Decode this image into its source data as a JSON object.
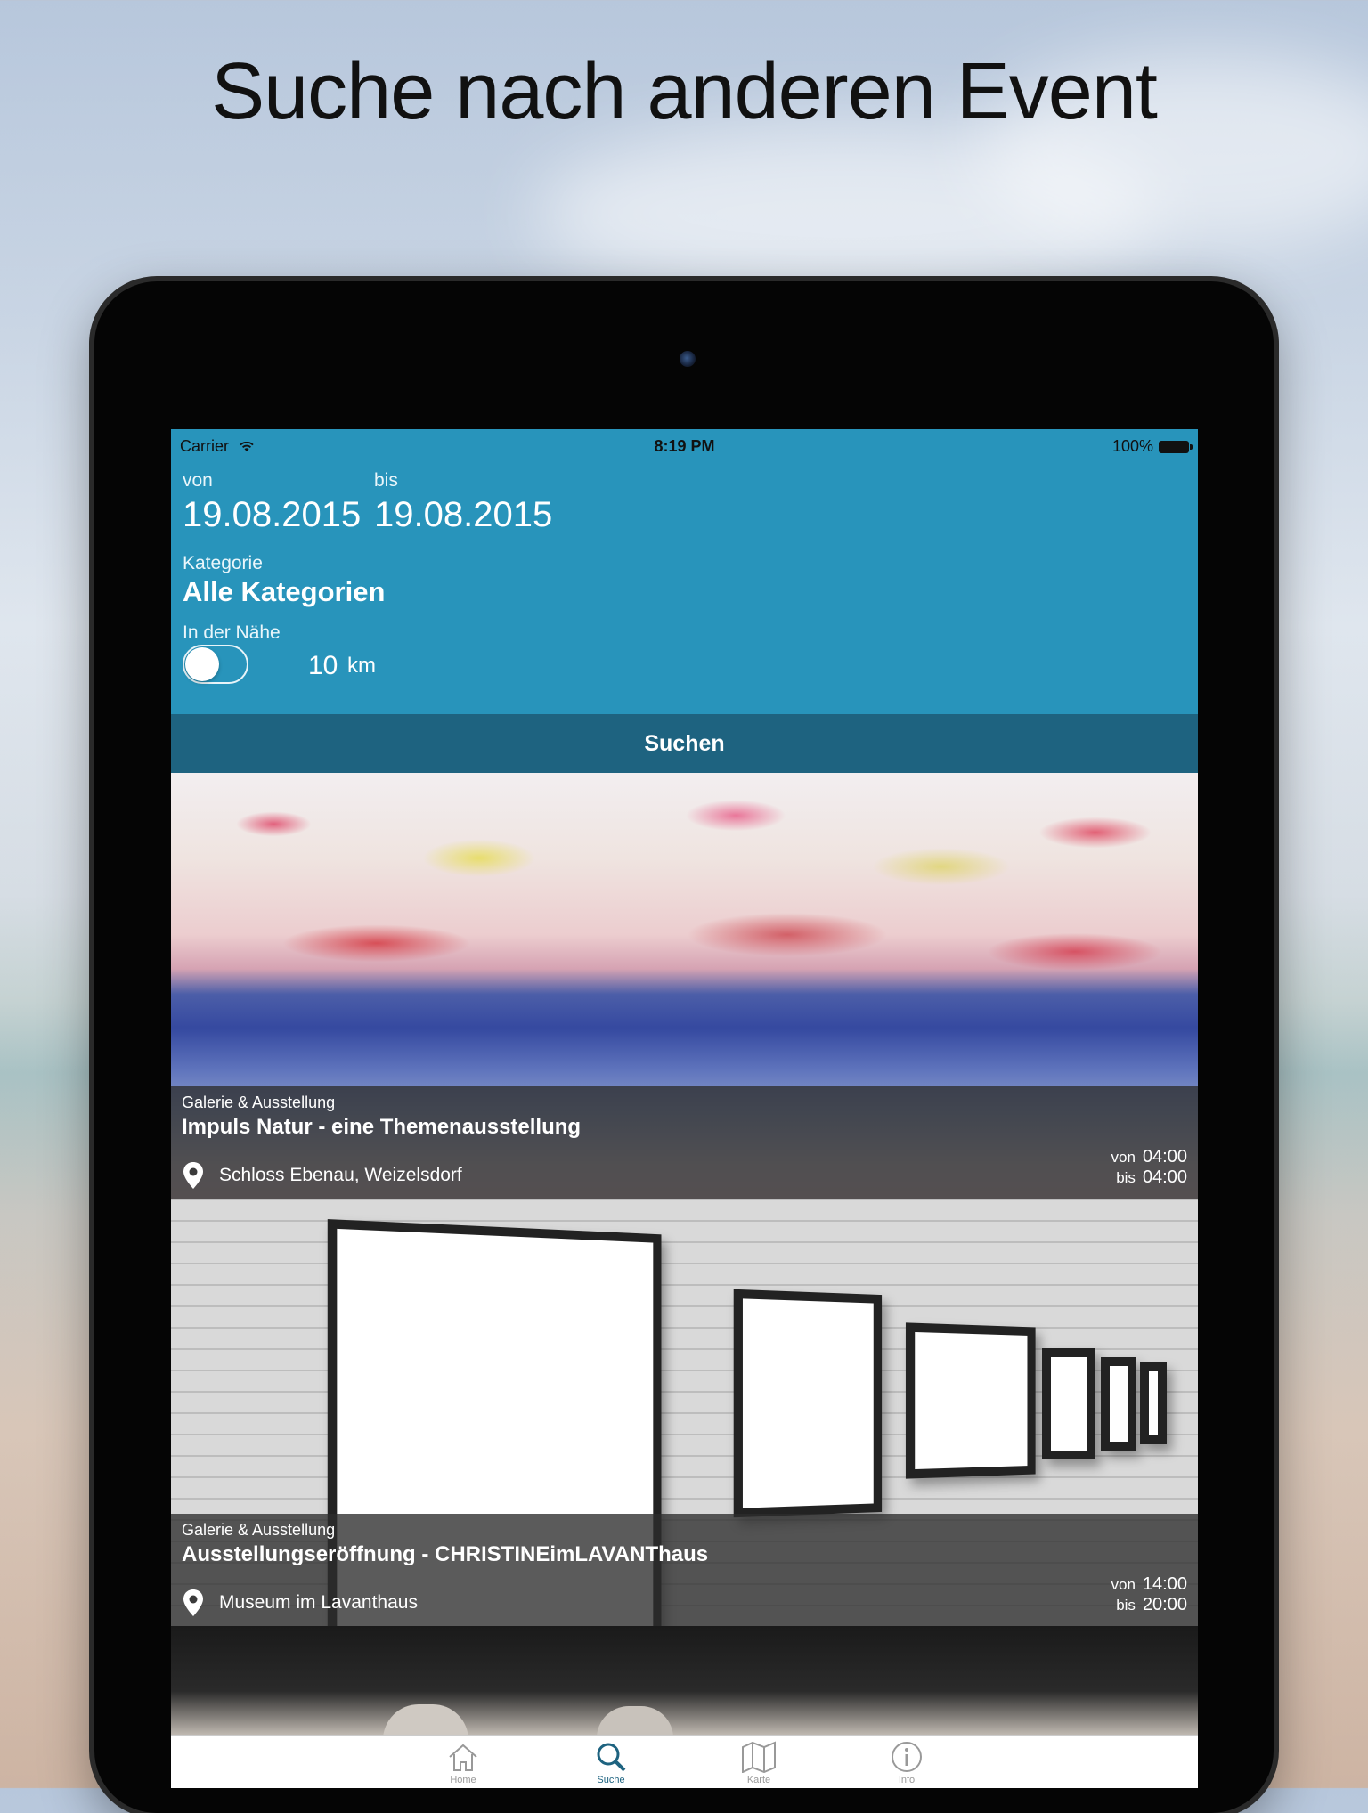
{
  "headline": "Suche nach anderen Event",
  "statusbar": {
    "carrier": "Carrier",
    "time": "8:19 PM",
    "battery": "100%"
  },
  "filters": {
    "from_label": "von",
    "from_date": "19.08.2015",
    "to_label": "bis",
    "to_date": "19.08.2015",
    "category_label": "Kategorie",
    "category_value": "Alle Kategorien",
    "nearby_label": "In der Nähe",
    "nearby_enabled": false,
    "distance_value": "10",
    "distance_unit": "km"
  },
  "search_button": "Suchen",
  "events": [
    {
      "category": "Galerie & Ausstellung",
      "title": "Impuls Natur - eine Themenausstellung",
      "location": "Schloss Ebenau, Weizelsdorf",
      "from_label": "von",
      "from_time": "04:00",
      "to_label": "bis",
      "to_time": "04:00"
    },
    {
      "category": "Galerie & Ausstellung",
      "title": "Ausstellungseröffnung - CHRISTINEimLAVANThaus",
      "location": "Museum im Lavanthaus",
      "from_label": "von",
      "from_time": "14:00",
      "to_label": "bis",
      "to_time": "20:00"
    }
  ],
  "tabbar": {
    "items": [
      {
        "icon": "home-icon",
        "label": "Home"
      },
      {
        "icon": "search-icon",
        "label": "Suche"
      },
      {
        "icon": "map-icon",
        "label": "Karte"
      },
      {
        "icon": "info-icon",
        "label": "Info"
      }
    ],
    "active_color": "#1e6380"
  },
  "colors": {
    "primary": "#2894bb",
    "button": "#1e6380"
  }
}
